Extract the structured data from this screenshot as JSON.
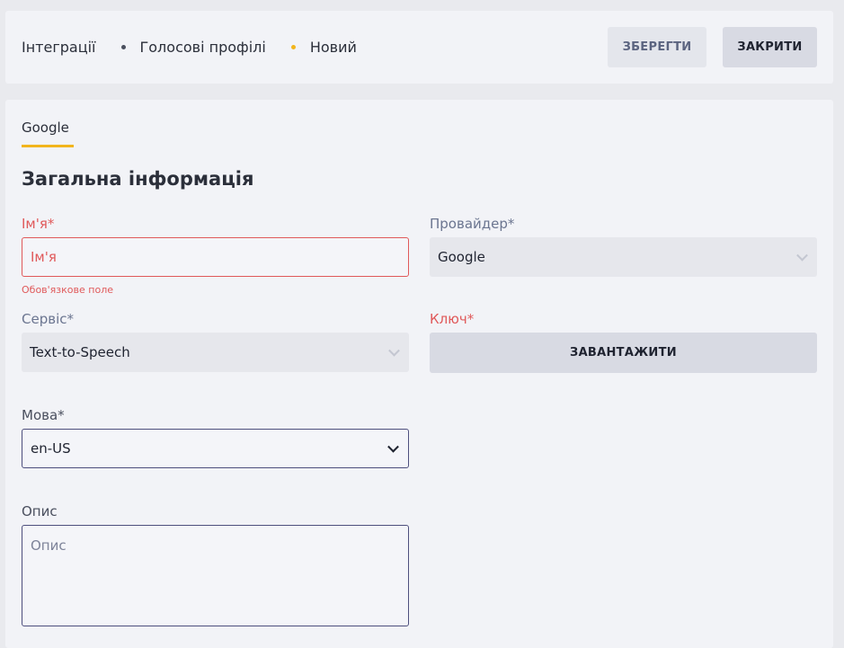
{
  "breadcrumb": {
    "items": [
      "Інтеграції",
      "Голосові профілі",
      "Новий"
    ]
  },
  "toolbar": {
    "save_label": "ЗБЕРЕГТИ",
    "close_label": "ЗАКРИТИ"
  },
  "tabs": [
    {
      "label": "Google",
      "active": true
    }
  ],
  "section": {
    "title": "Загальна інформація"
  },
  "form": {
    "name": {
      "label": "Ім'я*",
      "placeholder": "Ім'я",
      "value": "",
      "error": "Обов'язкове поле"
    },
    "provider": {
      "label": "Провайдер*",
      "value": "Google"
    },
    "service": {
      "label": "Сервіс*",
      "value": "Text-to-Speech"
    },
    "key": {
      "label": "Ключ*",
      "button_label": "ЗАВАНТАЖИТИ"
    },
    "language": {
      "label": "Мова*",
      "value": "en-US"
    },
    "description": {
      "label": "Опис",
      "placeholder": "Опис"
    }
  },
  "colors": {
    "accent": "#f2b51c",
    "error": "#e0595a",
    "focus_border": "#4d4f7d"
  }
}
